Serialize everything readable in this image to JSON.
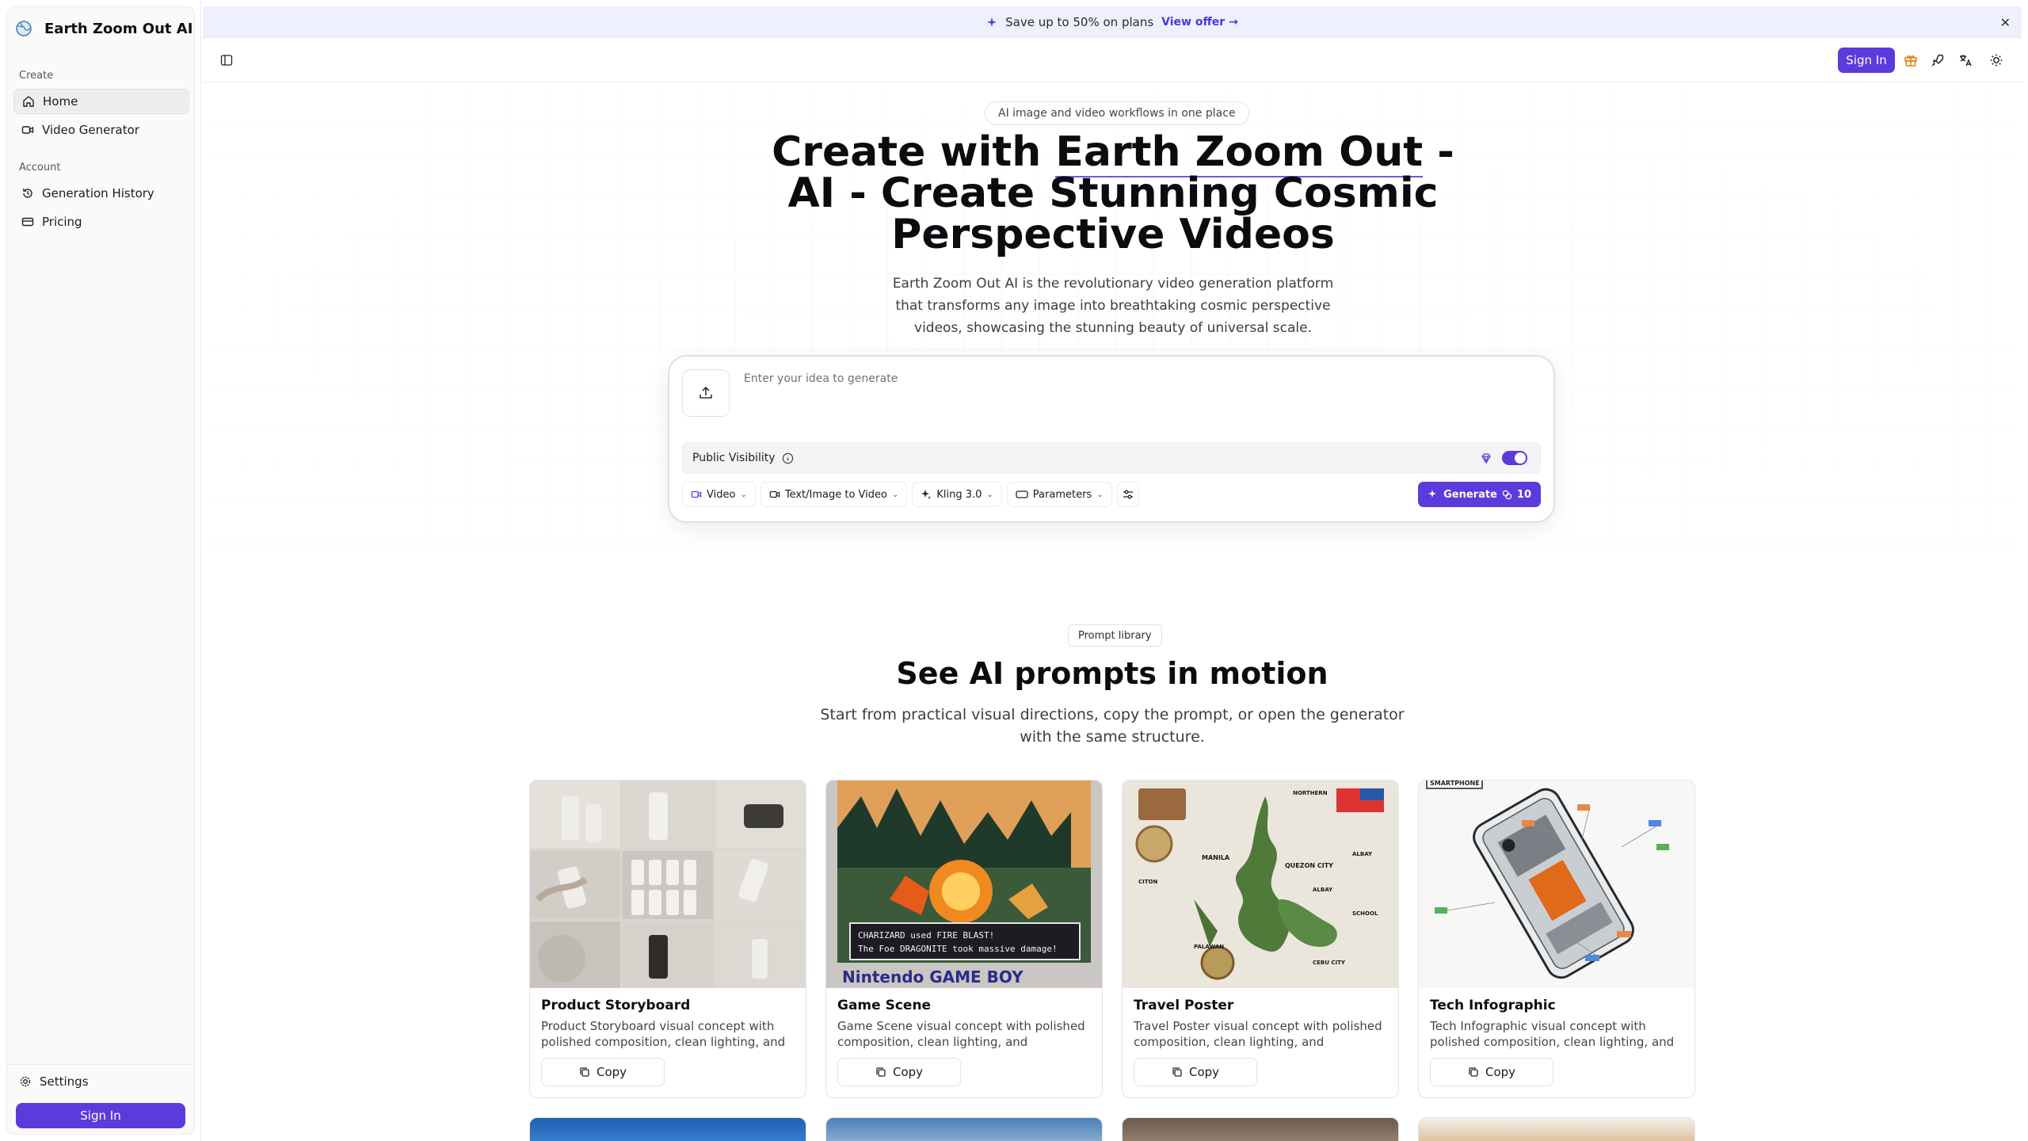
{
  "app": {
    "title": "Earth Zoom Out AI"
  },
  "sidebar": {
    "sections": [
      {
        "label": "Create",
        "items": [
          {
            "label": "Home",
            "active": true
          },
          {
            "label": "Video Generator"
          }
        ]
      },
      {
        "label": "Account",
        "items": [
          {
            "label": "Generation History"
          },
          {
            "label": "Pricing"
          }
        ]
      }
    ],
    "settings_label": "Settings",
    "signin_label": "Sign In"
  },
  "promo": {
    "text": "Save up to 50% on plans",
    "offer_label": "View offer →"
  },
  "header": {
    "signin_label": "Sign In",
    "icons": [
      "gift-icon",
      "rocket-icon",
      "translate-icon",
      "theme-sun-icon"
    ]
  },
  "hero": {
    "pill": "AI image and video workflows in one place",
    "title_prefix": "Create with ",
    "title_highlight": "Earth Zoom Out",
    "title_rest": " - AI - Create Stunning Cosmic Perspective Videos",
    "subtitle": "Earth Zoom Out AI is the revolutionary video generation platform that transforms any image into breathtaking cosmic perspective videos, showcasing the stunning beauty of universal scale."
  },
  "prompt": {
    "placeholder": "Enter your idea to generate",
    "visibility_label": "Public Visibility",
    "visibility_on": true,
    "controls": {
      "type": "Video",
      "mode": "Text/Image to Video",
      "model": "Kling 3.0",
      "params": "Parameters"
    },
    "generate_label": "Generate",
    "credit_cost": "10"
  },
  "library": {
    "pill": "Prompt library",
    "title": "See AI prompts in motion",
    "subtitle": "Start from practical visual directions, copy the prompt, or open the generator with the same structure.",
    "copy_label": "Copy",
    "cards": [
      {
        "title": "Product Storyboard",
        "desc": "Product Storyboard visual concept with polished composition, clean lighting, and production-ready detail."
      },
      {
        "title": "Game Scene",
        "desc": "Game Scene visual concept with polished composition, clean lighting, and production-ready detail.",
        "caption_line1": "CHARIZARD used FIRE BLAST!",
        "caption_line2": "The Foe DRAGONITE took massive damage!",
        "brand": "Nintendo GAME BOY"
      },
      {
        "title": "Travel Poster",
        "desc": "Travel Poster visual concept with polished composition, clean lighting, and production-ready detail.",
        "map_labels": [
          "NORTHERN",
          "ALBAY",
          "QUEZON CITY",
          "MANILA",
          "ALBAY",
          "CITON",
          "SCHOOL",
          "PALAWAN",
          "CEBU CITY"
        ]
      },
      {
        "title": "Tech Infographic",
        "desc": "Tech Infographic visual concept with polished composition, clean lighting, and production-ready detail.",
        "header_label": "SMARTPHONE"
      }
    ]
  },
  "colors": {
    "accent": "#5b3bdc",
    "promo_bg": "#eef0fd",
    "highlight_underline": "#6b5be6"
  }
}
